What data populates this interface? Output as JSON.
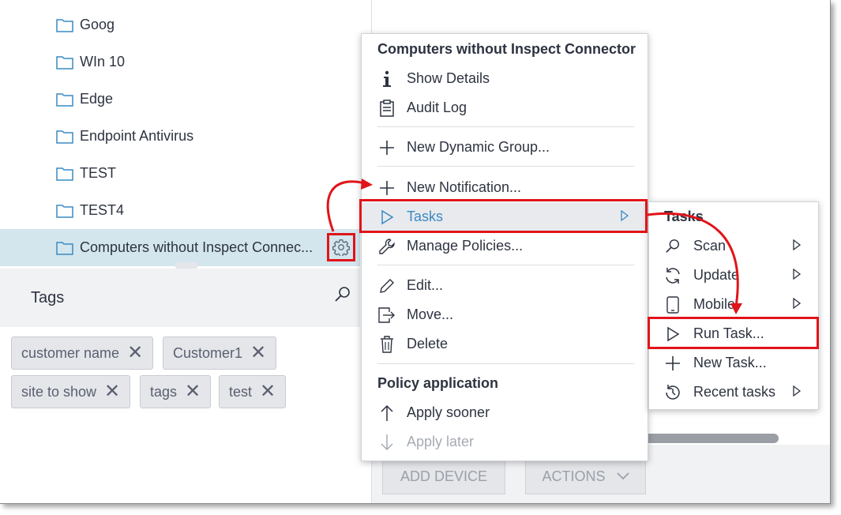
{
  "tree": {
    "items": [
      {
        "label": "Goog"
      },
      {
        "label": "WIn 10"
      },
      {
        "label": "Edge"
      },
      {
        "label": "Endpoint Antivirus"
      },
      {
        "label": "TEST"
      },
      {
        "label": "TEST4"
      },
      {
        "label": "Computers without Inspect Connec...",
        "selected": true
      }
    ]
  },
  "tags": {
    "title": "Tags",
    "chips": [
      {
        "label": "customer name"
      },
      {
        "label": "Customer1"
      },
      {
        "label": "site to show"
      },
      {
        "label": "tags"
      },
      {
        "label": "test"
      }
    ]
  },
  "toolbar": {
    "add_device": "ADD DEVICE",
    "actions": "ACTIONS"
  },
  "context_menu": {
    "title": "Computers without Inspect Connector",
    "show_details": "Show Details",
    "audit_log": "Audit Log",
    "new_dynamic_group": "New Dynamic Group...",
    "new_notification": "New Notification...",
    "tasks": "Tasks",
    "manage_policies": "Manage Policies...",
    "edit": "Edit...",
    "move": "Move...",
    "delete": "Delete",
    "policy_heading": "Policy application",
    "apply_sooner": "Apply sooner",
    "apply_later": "Apply later"
  },
  "tasks_submenu": {
    "title": "Tasks",
    "scan": "Scan",
    "update": "Update",
    "mobile": "Mobile",
    "run_task": "Run Task...",
    "new_task": "New Task...",
    "recent_tasks": "Recent tasks"
  },
  "colors": {
    "accent": "#3a8ac4",
    "annotation": "#e0141a",
    "selected_row": "#d3e6ee",
    "text": "#2d3340"
  }
}
